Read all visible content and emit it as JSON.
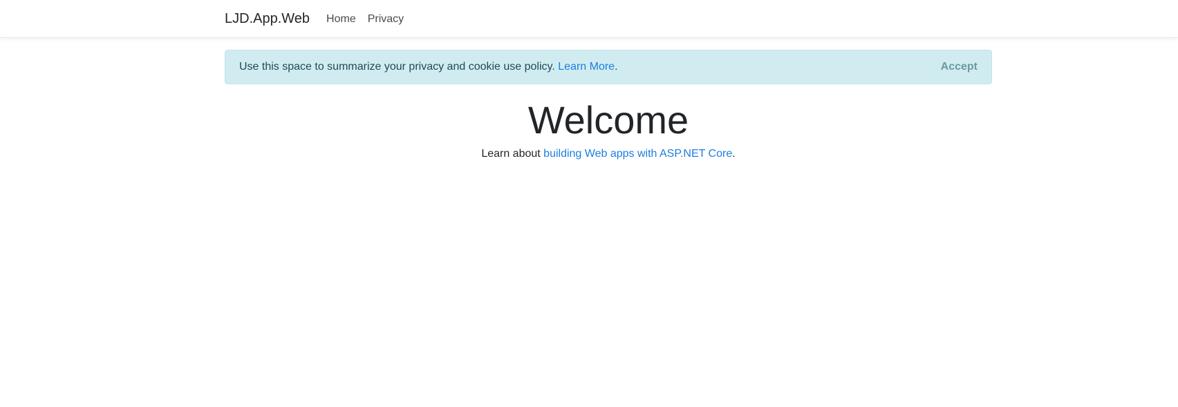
{
  "navbar": {
    "brand": "LJD.App.Web",
    "links": [
      {
        "label": "Home"
      },
      {
        "label": "Privacy"
      }
    ]
  },
  "cookie_banner": {
    "message": "Use this space to summarize your privacy and cookie use policy.",
    "learn_more": "Learn More",
    "period": ".",
    "accept": "Accept"
  },
  "main": {
    "title": "Welcome",
    "lead_prefix": "Learn about",
    "lead_link": "building Web apps with ASP.NET Core",
    "lead_suffix": "."
  },
  "colors": {
    "link": "#1b7ee0",
    "alert_bg": "#d1ecf1",
    "alert_border": "#bee5eb"
  }
}
